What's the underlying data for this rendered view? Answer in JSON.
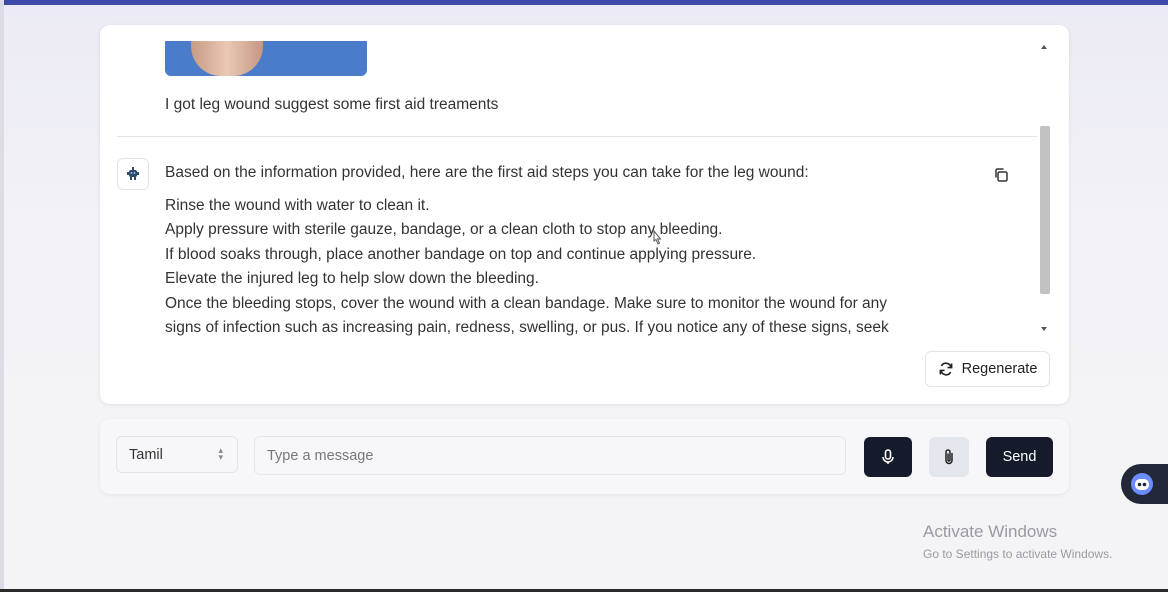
{
  "chat": {
    "user_message": "I got leg wound suggest some first aid treaments",
    "bot_intro": "Based on the information provided, here are the first aid steps you can take for the leg wound:",
    "bot_lines": [
      "Rinse the wound with water to clean it.",
      "Apply pressure with sterile gauze, bandage, or a clean cloth to stop any bleeding.",
      "If blood soaks through, place another bandage on top and continue applying pressure.",
      "Elevate the injured leg to help slow down the bleeding.",
      "Once the bleeding stops, cover the wound with a clean bandage. Make sure to monitor the wound for any",
      "signs of infection such as increasing pain, redness, swelling, or pus. If you notice any of these signs, seek"
    ],
    "regenerate_label": "Regenerate"
  },
  "input_bar": {
    "language": "Tamil",
    "placeholder": "Type a message",
    "send_label": "Send"
  },
  "watermark": {
    "title": "Activate Windows",
    "subtitle": "Go to Settings to activate Windows."
  },
  "icons": {
    "avatar": "bot-avatar-icon",
    "copy": "copy-icon",
    "regenerate": "refresh-icon",
    "mic": "microphone-icon",
    "attach": "paperclip-icon",
    "floating": "chatbot-icon"
  },
  "colors": {
    "dark_button": "#161b2c",
    "attach_button": "#e4e6ee",
    "top_bar": "#3d4aa8"
  }
}
